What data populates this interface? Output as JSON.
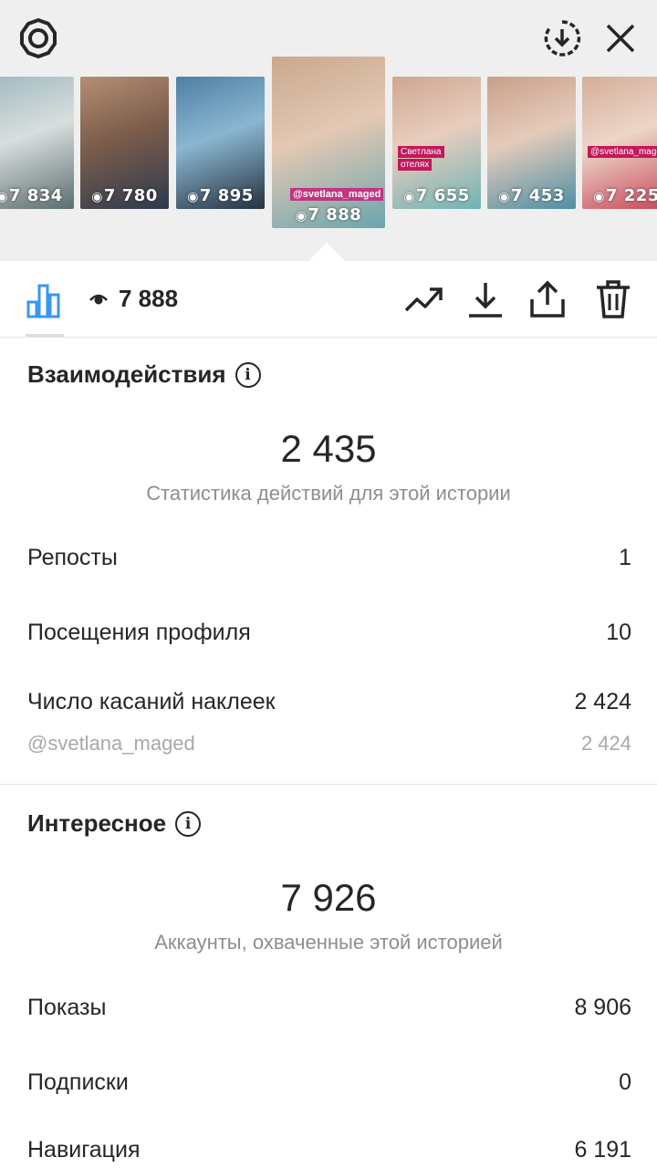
{
  "top_bar": {
    "icons": [
      "settings-icon",
      "download-circle-icon",
      "close-icon"
    ]
  },
  "stories": [
    {
      "views": "7 834",
      "colors": [
        "#9fb9bf",
        "#d8dede",
        "#5c6d6f"
      ]
    },
    {
      "views": "7 780",
      "colors": [
        "#b48e74",
        "#7c5d4b",
        "#2d3a4e"
      ]
    },
    {
      "views": "7 895",
      "colors": [
        "#4f7fa3",
        "#8ab6d1",
        "#26323f"
      ]
    },
    {
      "views": "7 888",
      "colors": [
        "#c9a88e",
        "#e3c8b3",
        "#6aa6ad"
      ],
      "selected": true,
      "sticker": "@svetlana_maged"
    },
    {
      "views": "7 655",
      "colors": [
        "#cfa692",
        "#e8cdbd",
        "#6fb3b4"
      ],
      "overlay": [
        "Светлана",
        "отелях"
      ]
    },
    {
      "views": "7 453",
      "colors": [
        "#c99f88",
        "#e5cbbb",
        "#4d8fa4"
      ]
    },
    {
      "views": "7 225",
      "colors": [
        "#d5ad98",
        "#ecd6c8",
        "#c7475a"
      ],
      "overlay": [
        "@svetlana_maged"
      ]
    }
  ],
  "toolbar": {
    "views_label": "7 888",
    "icons": [
      "insights-bar-icon",
      "eye-icon",
      "trending-icon",
      "download-icon",
      "share-icon",
      "trash-icon"
    ]
  },
  "interactions": {
    "title": "Взаимодействия",
    "total": "2 435",
    "subtitle": "Статистика действий для этой истории",
    "rows": [
      {
        "label": "Репосты",
        "value": "1"
      },
      {
        "label": "Посещения профиля",
        "value": "10"
      },
      {
        "label": "Число касаний наклеек",
        "value": "2 424"
      }
    ],
    "sticker_row": {
      "label": "@svetlana_maged",
      "value": "2 424"
    }
  },
  "discovery": {
    "title": "Интересное",
    "total": "7 926",
    "subtitle": "Аккаунты, охваченные этой историей",
    "rows": [
      {
        "label": "Показы",
        "value": "8 906"
      },
      {
        "label": "Подписки",
        "value": "0"
      },
      {
        "label": "Навигация",
        "value": "6 191"
      }
    ]
  },
  "colors": {
    "accent_blue": "#3897f0",
    "text": "#262626",
    "secondary": "#8e8e8e"
  }
}
